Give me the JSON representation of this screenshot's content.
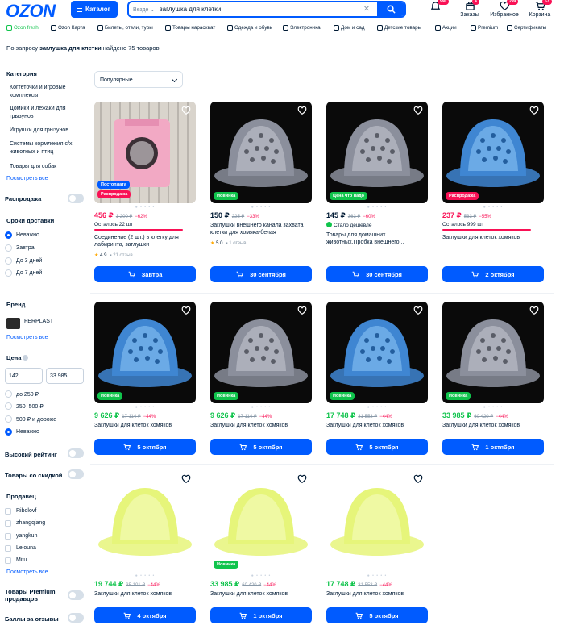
{
  "header": {
    "logo": "OZON",
    "catalog_label": "Каталог",
    "search_scope": "Везде",
    "search_value": "заглушка для клетки",
    "icons": [
      {
        "name": "bell-icon",
        "label": "",
        "badge": "990"
      },
      {
        "name": "box-icon",
        "label": "Заказы",
        "badge": "4"
      },
      {
        "name": "heart-icon",
        "label": "Избранное",
        "badge": "299"
      },
      {
        "name": "cart-icon",
        "label": "Корзина",
        "badge": "67"
      }
    ]
  },
  "nav": [
    {
      "label": "Ozon fresh",
      "green": true
    },
    {
      "label": "Ozon Карта"
    },
    {
      "label": "Билеты, отели, туры"
    },
    {
      "label": "Товары нарасхват"
    },
    {
      "label": "Одежда и обувь"
    },
    {
      "label": "Электроника"
    },
    {
      "label": "Дом и сад"
    },
    {
      "label": "Детские товары"
    },
    {
      "label": "Акции"
    },
    {
      "label": "Premium"
    },
    {
      "label": "Сертификаты"
    }
  ],
  "summary": {
    "prefix": "По запросу ",
    "query": "заглушка для клетки",
    "suffix": " найдено 75 товаров"
  },
  "sidebar": {
    "category_title": "Категория",
    "categories": [
      "Когтеточки и игровые комплексы",
      "Домики и лежаки для грызунов",
      "Игрушки для грызунов",
      "Системы кормления с/х животных и птиц",
      "Товары для собак"
    ],
    "see_all": "Посмотреть все",
    "sale": "Распродажа",
    "delivery_title": "Сроки доставки",
    "delivery": [
      "Неважно",
      "Завтра",
      "До 3 дней",
      "До 7 дней"
    ],
    "brand_title": "Бренд",
    "brand": "FERPLAST",
    "price_title": "Цена",
    "price_from": "142",
    "price_to": "33 985",
    "price_ranges": [
      "до 250 ₽",
      "250–500 ₽",
      "500 ₽ и дороже",
      "Неважно"
    ],
    "high_rating": "Высокий рейтинг",
    "discount": "Товары со скидкой",
    "seller_title": "Продавец",
    "sellers": [
      "Ribolovf",
      "zhangqiang",
      "yangkun",
      "Leiouna",
      "Mitu"
    ],
    "premium": "Товары Premium продавцов",
    "reviews_points": "Баллы за отзывы"
  },
  "sort_label": "Популярные",
  "products": [
    {
      "img": "photo",
      "tags": [
        {
          "t": "Постоплата",
          "c": "b"
        },
        {
          "t": "Распродажа",
          "c": "p"
        }
      ],
      "price": "456 ₽",
      "red": true,
      "old": "1 200 ₽",
      "disc": "−62%",
      "left": "Осталось 22 шт",
      "title": "Соединение (2 шт.) в клетку для лабиринта, заглушки",
      "rating": "4.9",
      "reviews": "21 отзыв",
      "delivery": "Завтра"
    },
    {
      "img": "clear",
      "tags": [
        {
          "t": "Новинка",
          "c": "g"
        }
      ],
      "price": "150 ₽",
      "old": "225 ₽",
      "disc": "−33%",
      "title": "Заглушки внешнего канала захвата клетки для хомяка-белая",
      "rating": "5.0",
      "reviews": "1 отзыв",
      "delivery": "30 сентября"
    },
    {
      "img": "clear",
      "tags": [
        {
          "t": "Цена что надо",
          "c": "g"
        }
      ],
      "price": "145 ₽",
      "old": "363 ₽",
      "disc": "−60%",
      "good": "Стало дешевле",
      "title": "Товары для домашних животных,Пробка внешнего...",
      "delivery": "30 сентября"
    },
    {
      "img": "blue",
      "tags": [
        {
          "t": "Распродажа",
          "c": "p"
        }
      ],
      "price": "237 ₽",
      "red": true,
      "old": "533 ₽",
      "disc": "−55%",
      "left": "Осталось 999 шт",
      "title": "Заглушки для клеток хомяков",
      "delivery": "2 октября"
    },
    {
      "img": "blue",
      "tags": [
        {
          "t": "Новинка",
          "c": "g"
        }
      ],
      "price": "9 626 ₽",
      "green": true,
      "old": "17 114 ₽",
      "disc": "−44%",
      "title": "Заглушки для клеток хомяков",
      "delivery": "5 октября"
    },
    {
      "img": "clear",
      "tags": [
        {
          "t": "Новинка",
          "c": "g"
        }
      ],
      "price": "9 626 ₽",
      "green": true,
      "old": "17 114 ₽",
      "disc": "−44%",
      "title": "Заглушки для клеток хомяков",
      "delivery": "5 октября"
    },
    {
      "img": "blue",
      "tags": [
        {
          "t": "Новинка",
          "c": "g"
        }
      ],
      "price": "17 748 ₽",
      "green": true,
      "old": "31 553 ₽",
      "disc": "−44%",
      "title": "Заглушки для клеток хомяков",
      "delivery": "5 октября"
    },
    {
      "img": "clear",
      "tags": [
        {
          "t": "Новинка",
          "c": "g"
        }
      ],
      "price": "33 985 ₽",
      "green": true,
      "old": "60 420 ₽",
      "disc": "−44%",
      "title": "Заглушки для клеток хомяков",
      "delivery": "1 октября"
    },
    {
      "img": "yellow",
      "tags": [],
      "price": "19 744 ₽",
      "green": true,
      "old": "35 101 ₽",
      "disc": "−44%",
      "title": "Заглушки для клеток хомяков",
      "delivery": "4 октября"
    },
    {
      "img": "yellow",
      "tags": [
        {
          "t": "Новинка",
          "c": "g"
        }
      ],
      "price": "33 985 ₽",
      "green": true,
      "old": "60 420 ₽",
      "disc": "−44%",
      "title": "Заглушки для клеток хомяков",
      "delivery": "1 октября"
    },
    {
      "img": "yellow",
      "tags": [],
      "price": "17 748 ₽",
      "green": true,
      "old": "31 553 ₽",
      "disc": "−44%",
      "title": "Заглушки для клеток хомяков",
      "delivery": "5 октября"
    }
  ]
}
